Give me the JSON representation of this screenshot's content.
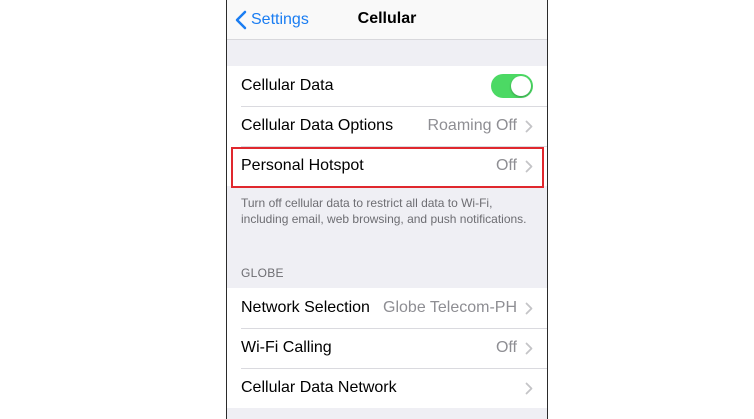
{
  "navbar": {
    "back_label": "Settings",
    "title": "Cellular"
  },
  "group1": {
    "cellular_data": {
      "label": "Cellular Data",
      "toggle_on": true
    },
    "cellular_data_options": {
      "label": "Cellular Data Options",
      "value": "Roaming Off"
    },
    "personal_hotspot": {
      "label": "Personal Hotspot",
      "value": "Off"
    }
  },
  "footnote": "Turn off cellular data to restrict all data to Wi-Fi, including email, web browsing, and push notifications.",
  "section_globe": {
    "header": "GLOBE",
    "network_selection": {
      "label": "Network Selection",
      "value": "Globe Telecom-PH"
    },
    "wifi_calling": {
      "label": "Wi-Fi Calling",
      "value": "Off"
    },
    "cellular_data_network": {
      "label": "Cellular Data Network"
    }
  },
  "colors": {
    "accent": "#1a7df2",
    "toggle_on": "#4cd964",
    "highlight": "#e0282e",
    "background": "#efeff4"
  }
}
